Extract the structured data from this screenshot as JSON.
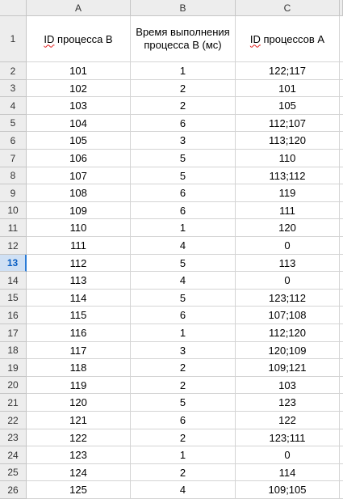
{
  "columns": [
    "A",
    "B",
    "C"
  ],
  "header_row": {
    "row_num": "1",
    "a_prefix": "ID",
    "a_rest": " процесса B",
    "b_line1": "Время выполнения",
    "b_line2": "процесса B (мс)",
    "c_prefix": "ID",
    "c_rest": " процессов A"
  },
  "selected_row": "13",
  "rows": [
    {
      "n": "2",
      "a": "101",
      "b": "1",
      "c": "122;117"
    },
    {
      "n": "3",
      "a": "102",
      "b": "2",
      "c": "101"
    },
    {
      "n": "4",
      "a": "103",
      "b": "2",
      "c": "105"
    },
    {
      "n": "5",
      "a": "104",
      "b": "6",
      "c": "112;107"
    },
    {
      "n": "6",
      "a": "105",
      "b": "3",
      "c": "113;120"
    },
    {
      "n": "7",
      "a": "106",
      "b": "5",
      "c": "110"
    },
    {
      "n": "8",
      "a": "107",
      "b": "5",
      "c": "113;112"
    },
    {
      "n": "9",
      "a": "108",
      "b": "6",
      "c": "119"
    },
    {
      "n": "10",
      "a": "109",
      "b": "6",
      "c": "111"
    },
    {
      "n": "11",
      "a": "110",
      "b": "1",
      "c": "120"
    },
    {
      "n": "12",
      "a": "111",
      "b": "4",
      "c": "0"
    },
    {
      "n": "13",
      "a": "112",
      "b": "5",
      "c": "113"
    },
    {
      "n": "14",
      "a": "113",
      "b": "4",
      "c": "0"
    },
    {
      "n": "15",
      "a": "114",
      "b": "5",
      "c": "123;112"
    },
    {
      "n": "16",
      "a": "115",
      "b": "6",
      "c": "107;108"
    },
    {
      "n": "17",
      "a": "116",
      "b": "1",
      "c": "112;120"
    },
    {
      "n": "18",
      "a": "117",
      "b": "3",
      "c": "120;109"
    },
    {
      "n": "19",
      "a": "118",
      "b": "2",
      "c": "109;121"
    },
    {
      "n": "20",
      "a": "119",
      "b": "2",
      "c": "103"
    },
    {
      "n": "21",
      "a": "120",
      "b": "5",
      "c": "123"
    },
    {
      "n": "22",
      "a": "121",
      "b": "6",
      "c": "122"
    },
    {
      "n": "23",
      "a": "122",
      "b": "2",
      "c": "123;111"
    },
    {
      "n": "24",
      "a": "123",
      "b": "1",
      "c": "0"
    },
    {
      "n": "25",
      "a": "124",
      "b": "2",
      "c": "114"
    },
    {
      "n": "26",
      "a": "125",
      "b": "4",
      "c": "109;105"
    }
  ]
}
